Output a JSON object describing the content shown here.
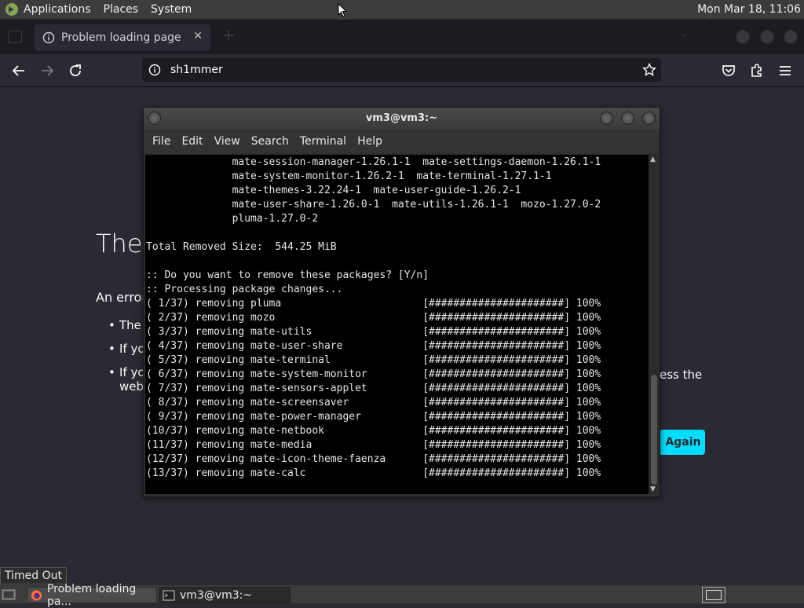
{
  "top_panel": {
    "menus": [
      "Applications",
      "Places",
      "System"
    ],
    "clock": "Mon Mar 18, 11:06"
  },
  "browser": {
    "tab_title": "Problem loading page",
    "url": "sh1mmer"
  },
  "page": {
    "title": "The",
    "intro": "An error",
    "list": [
      "The s",
      "If you",
      "If you"
    ],
    "list_cont": "web",
    "tail": "ess the",
    "try_again": "Again"
  },
  "terminal": {
    "title": "vm3@vm3:~",
    "menus": [
      "File",
      "Edit",
      "View",
      "Search",
      "Terminal",
      "Help"
    ],
    "lines": [
      "              mate-session-manager-1.26.1-1  mate-settings-daemon-1.26.1-1",
      "              mate-system-monitor-1.26.2-1  mate-terminal-1.27.1-1",
      "              mate-themes-3.22.24-1  mate-user-guide-1.26.2-1",
      "              mate-user-share-1.26.0-1  mate-utils-1.26.1-1  mozo-1.27.0-2",
      "              pluma-1.27.0-2",
      "",
      "Total Removed Size:  544.25 MiB",
      "",
      ":: Do you want to remove these packages? [Y/n]",
      ":: Processing package changes...",
      "( 1/37) removing pluma                       [######################] 100%",
      "( 2/37) removing mozo                        [######################] 100%",
      "( 3/37) removing mate-utils                  [######################] 100%",
      "( 4/37) removing mate-user-share             [######################] 100%",
      "( 5/37) removing mate-terminal               [######################] 100%",
      "( 6/37) removing mate-system-monitor         [######################] 100%",
      "( 7/37) removing mate-sensors-applet         [######################] 100%",
      "( 8/37) removing mate-screensaver            [######################] 100%",
      "( 9/37) removing mate-power-manager          [######################] 100%",
      "(10/37) removing mate-netbook                [######################] 100%",
      "(11/37) removing mate-media                  [######################] 100%",
      "(12/37) removing mate-icon-theme-faenza      [######################] 100%",
      "(13/37) removing mate-calc                   [######################] 100%"
    ]
  },
  "tooltip": "Timed Out",
  "taskbar": {
    "firefox_label": "Problem loading pa...",
    "terminal_label": "vm3@vm3:~"
  },
  "colors": {
    "accent": "#00ddff",
    "page_bg": "#2b2a33",
    "terminal_bg": "#000000"
  }
}
